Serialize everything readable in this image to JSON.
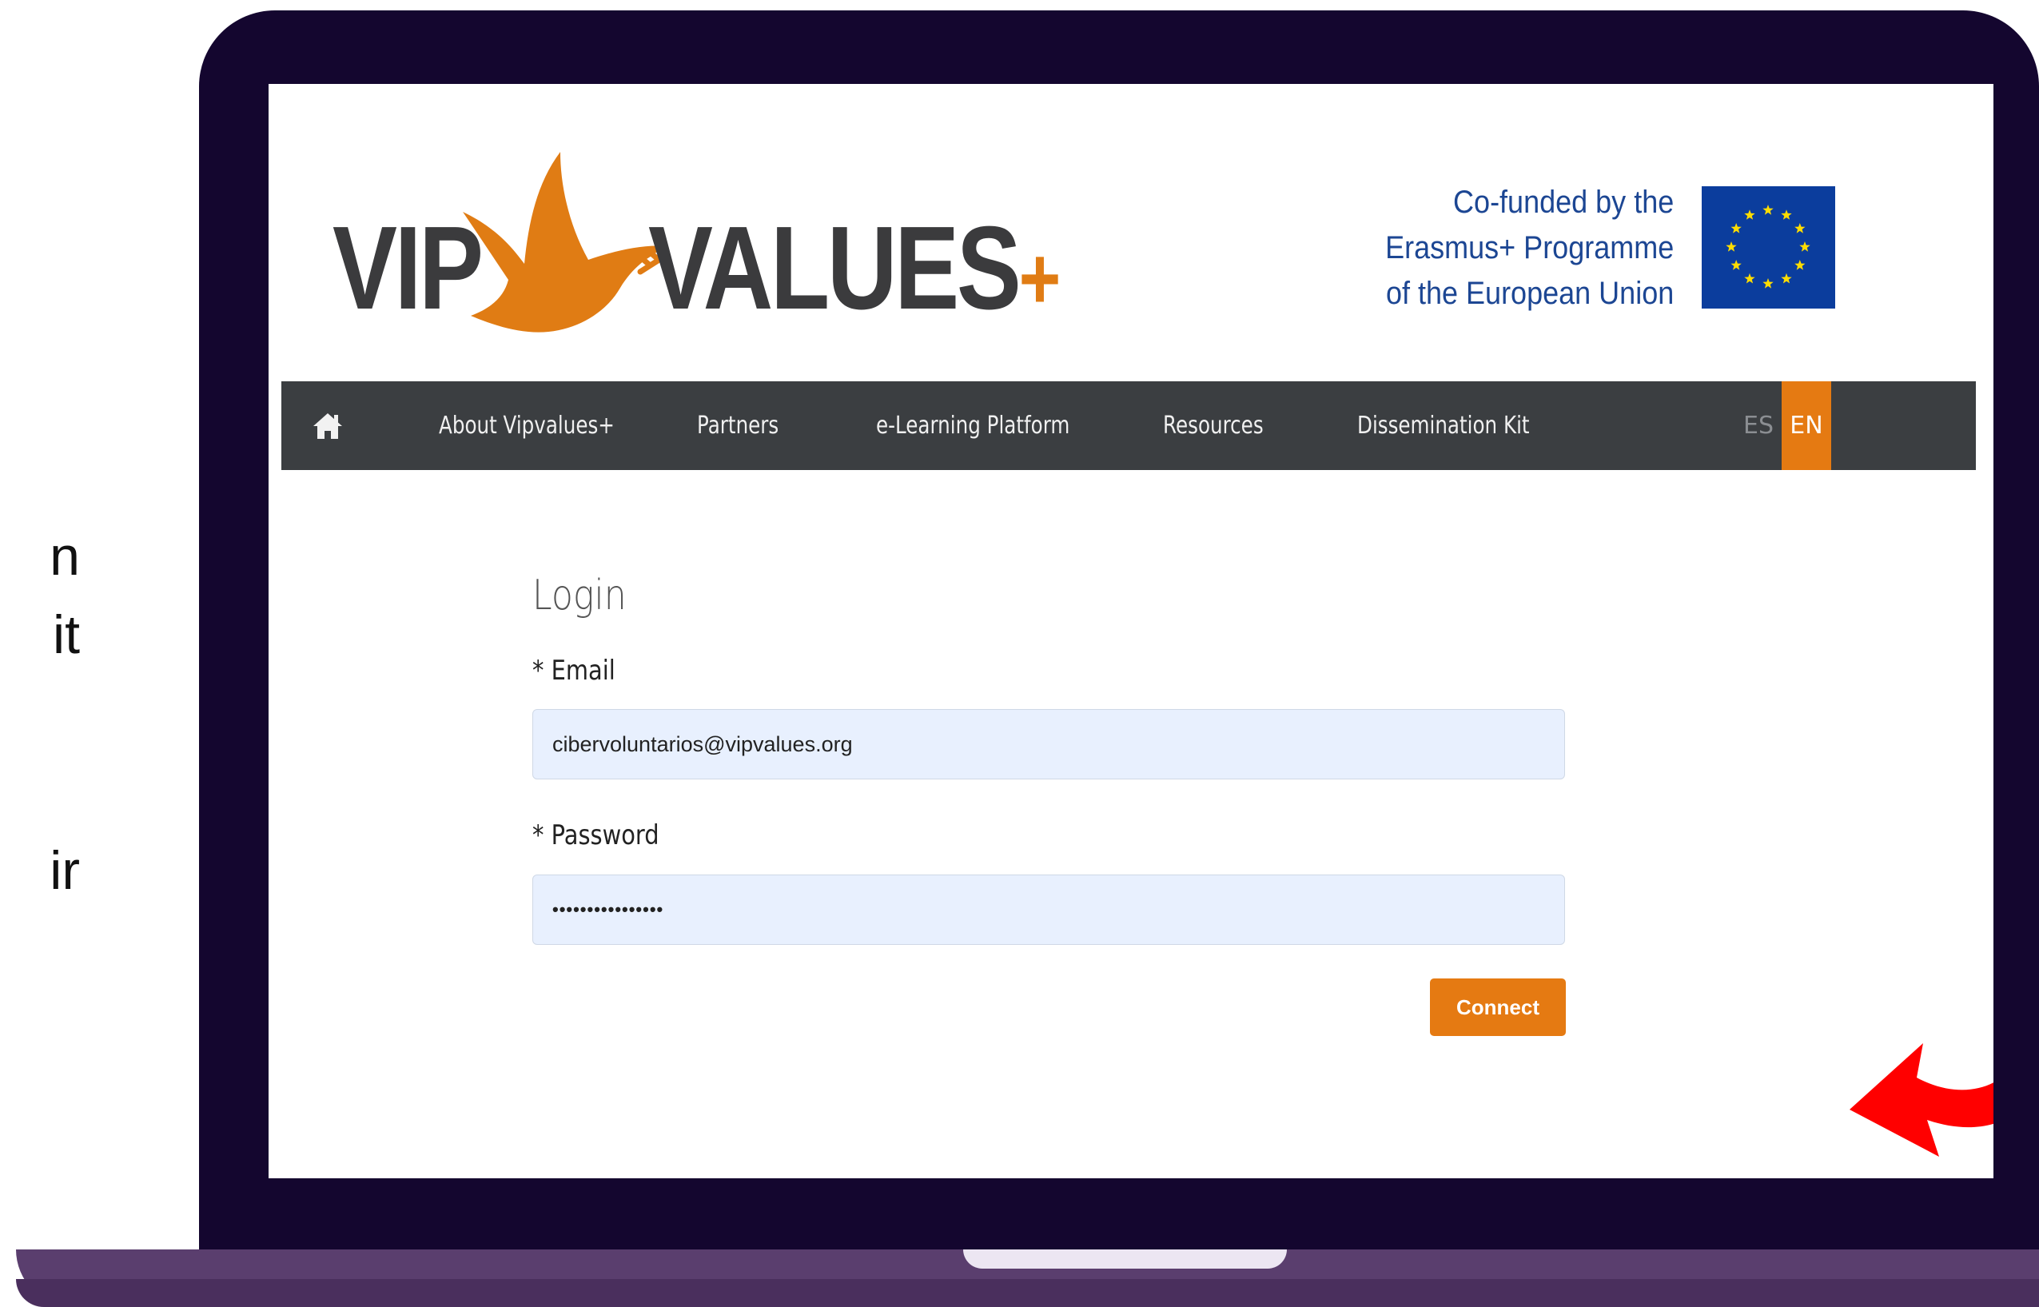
{
  "side_text": [
    "n",
    "it",
    "ir"
  ],
  "header": {
    "logo_text_left": "VIP",
    "logo_text_right": "VALUES",
    "logo_plus": "+",
    "eu_lines": [
      "Co-funded by the",
      "Erasmus+ Programme",
      "of the European Union"
    ]
  },
  "nav": {
    "home_icon": "home-icon",
    "items": [
      "About Vipvalues+",
      "Partners",
      "e-Learning Platform",
      "Resources",
      "Dissemination Kit"
    ],
    "lang_es": "ES",
    "lang_en": "EN"
  },
  "login": {
    "title": "Login",
    "email_label": "* Email",
    "email_value": "cibervoluntarios@vipvalues.org",
    "password_label": "* Password",
    "password_value": "••••••••••••••••",
    "button": "Connect"
  },
  "colors": {
    "accent": "#e57a12",
    "navbar": "#3b3e41",
    "input_bg": "#e8f0fe",
    "bezel": "#14062f",
    "arrow": "#ff0000",
    "eu_blue": "#0b3d9d"
  }
}
